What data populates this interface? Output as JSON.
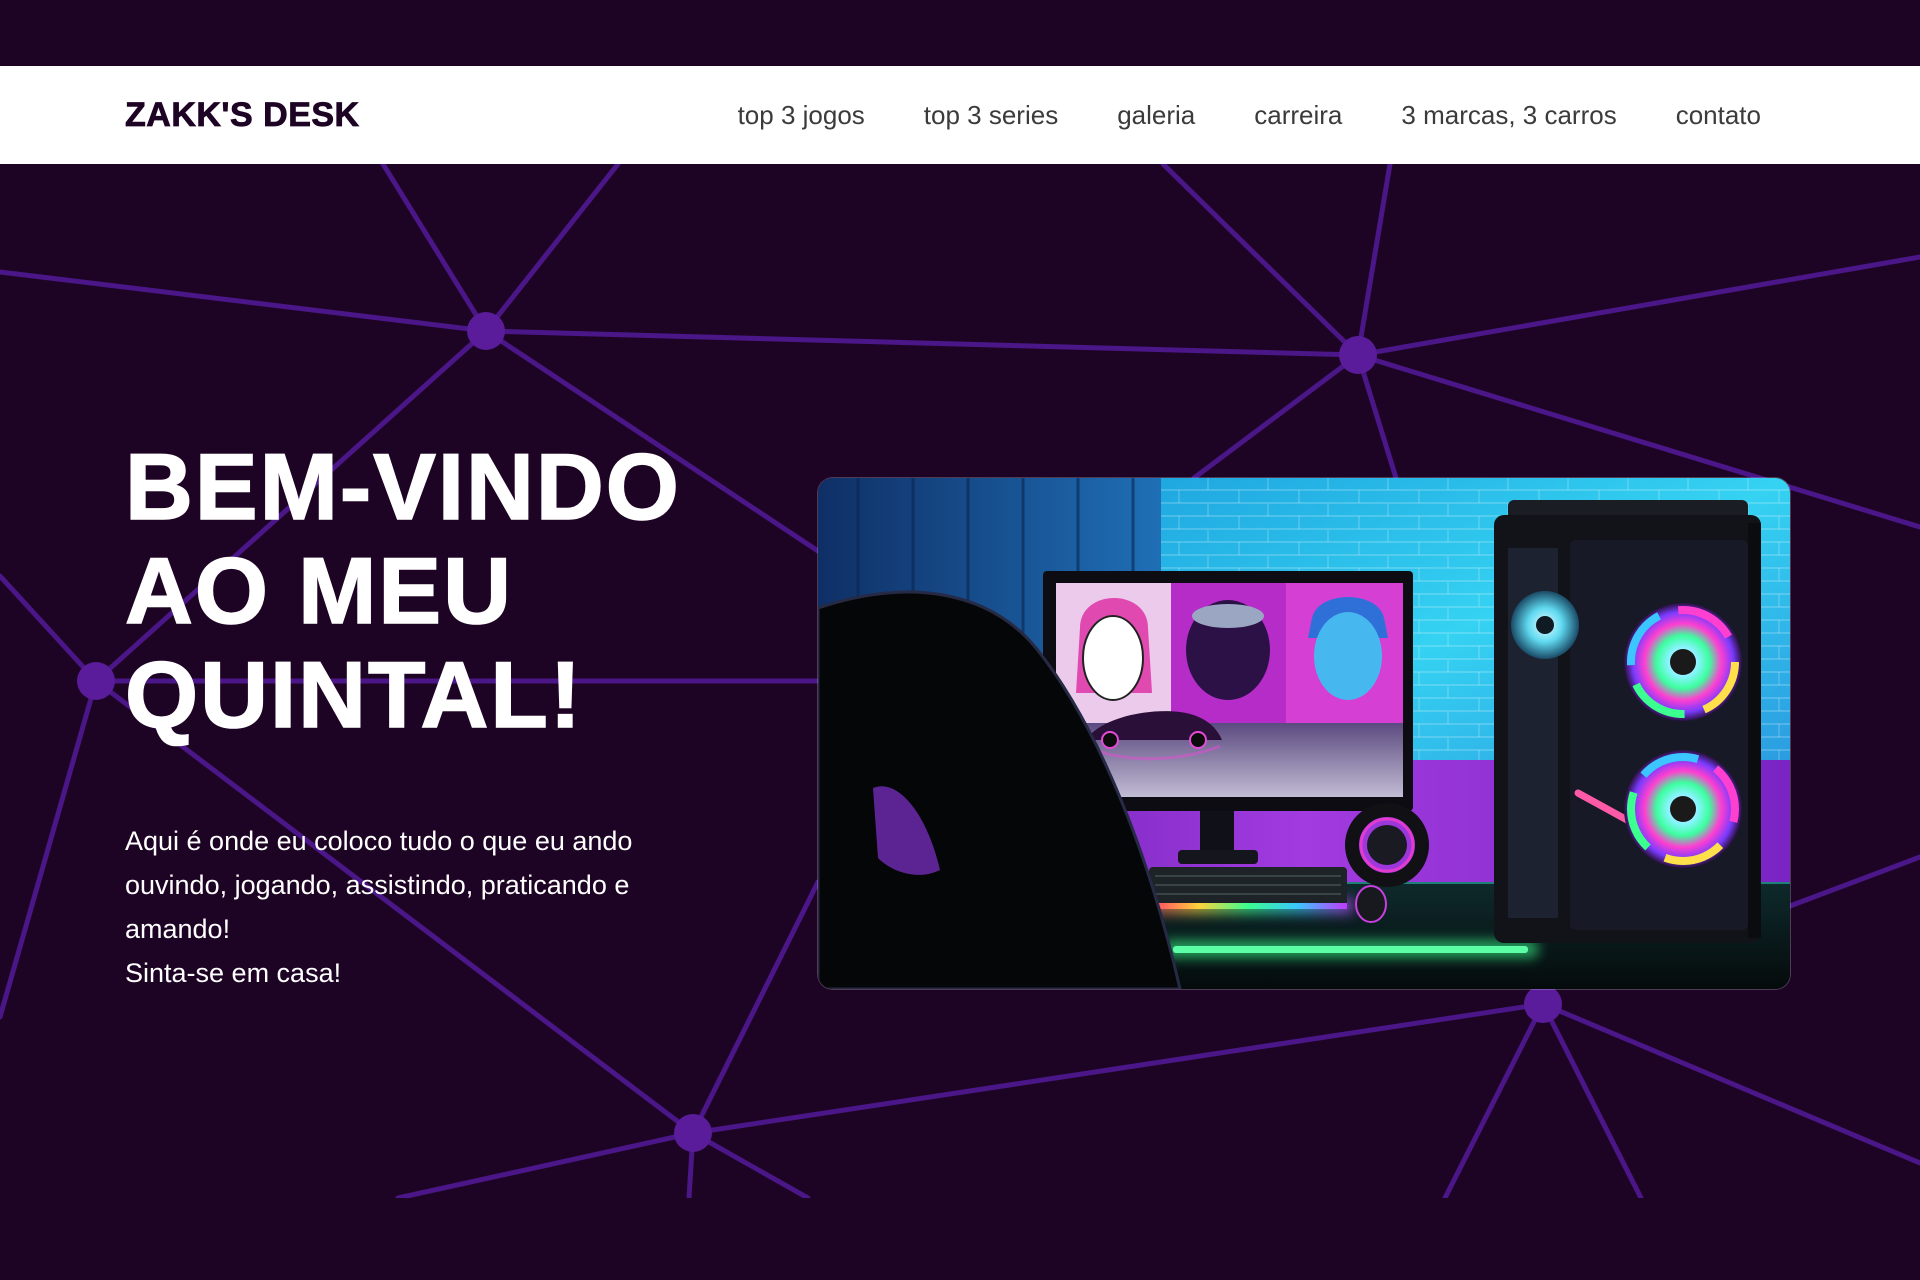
{
  "colors": {
    "page_background": "#1e0424",
    "header_background": "#ffffff",
    "logo": "#1e0424",
    "nav_text": "#3b3b3b",
    "hero_text": "#ffffff",
    "network_line": "#4a1688",
    "network_node": "#5a1c9b"
  },
  "header": {
    "logo": "ZAKK'S DESK",
    "nav": [
      {
        "label": "top 3 jogos"
      },
      {
        "label": "top 3 series"
      },
      {
        "label": "galeria"
      },
      {
        "label": "carreira"
      },
      {
        "label": "3 marcas, 3 carros"
      },
      {
        "label": "contato"
      }
    ]
  },
  "hero": {
    "title_lines": [
      "BEM-VINDO",
      "AO MEU",
      "QUINTAL!"
    ],
    "description": "Aqui é onde eu coloco tudo o que eu ando ouvindo, jogando, assistindo, praticando e amando!",
    "tagline": "Sinta-se em casa!",
    "image": {
      "icon": "gaming-setup-photo"
    }
  }
}
